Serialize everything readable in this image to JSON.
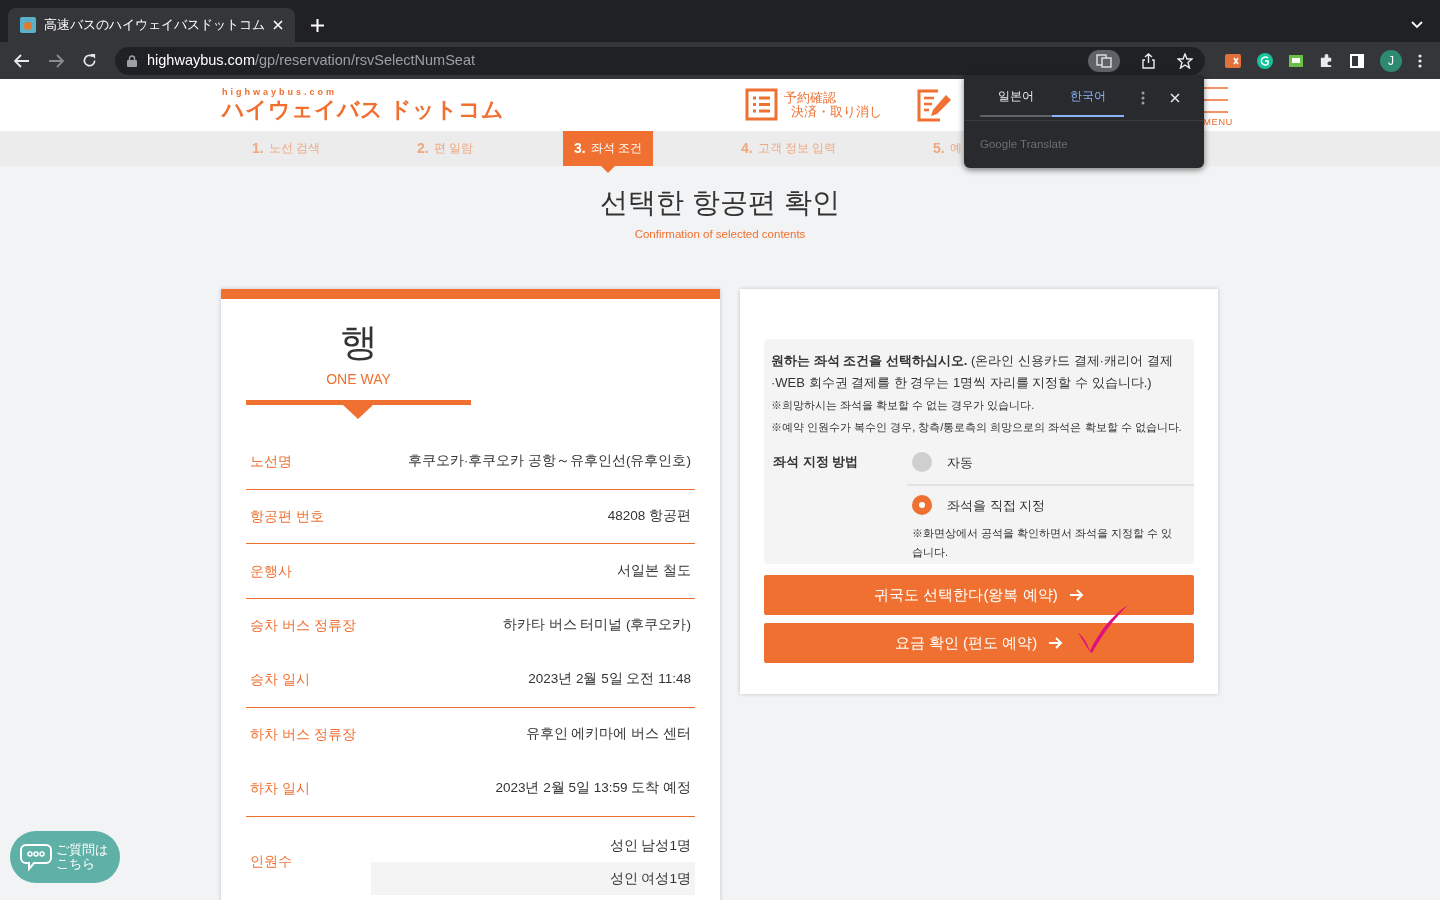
{
  "browser": {
    "tab_title": "高速バスのハイウェイバスドットコム",
    "url_host": "highwaybus.com",
    "url_path": "/gp/reservation/rsvSelectNumSeat",
    "profile_initial": "J"
  },
  "translate_popup": {
    "tabs": [
      {
        "label": "일본어",
        "selected": false
      },
      {
        "label": "한국어",
        "selected": true
      }
    ],
    "footer": "Google Translate"
  },
  "header": {
    "logo_small": "highwaybus.com",
    "logo": "ハイウェイバス ドットコム",
    "links": [
      {
        "line1": "予約確認",
        "line2": "決済・取り消し"
      }
    ],
    "menu": "MENU"
  },
  "steps": [
    {
      "number": "1.",
      "label": "노선 검색",
      "selected": false
    },
    {
      "number": "2.",
      "label": "편 일람",
      "selected": false
    },
    {
      "number": "3.",
      "label": "좌석 조건",
      "selected": true
    },
    {
      "number": "4.",
      "label": "고객 정보 입력",
      "selected": false
    },
    {
      "number": "5.",
      "label": "예",
      "selected": false
    }
  ],
  "title": "선택한 항공편 확인",
  "subtitle": "Confirmation of selected contents",
  "trip": {
    "kind_label": "행",
    "kind_sub": "ONE WAY",
    "rows": [
      {
        "label": "노선명",
        "values": [
          "후쿠오카·후쿠오카 공항～유후인선(유후인호)"
        ],
        "ruled_above": false
      },
      {
        "label": "항공편 번호",
        "values": [
          "48208 항공편"
        ],
        "ruled_above": true
      },
      {
        "label": "운행사",
        "values": [
          "서일본 철도"
        ],
        "ruled_above": true
      },
      {
        "label": "승차 버스 정류장",
        "values": [
          "하카타 버스 터미널 (후쿠오카)"
        ],
        "ruled_above": true
      },
      {
        "label": "승차 일시",
        "values": [
          "2023년 2월 5일 오전 11:48"
        ],
        "ruled_above": false
      },
      {
        "label": "하차 버스 정류장",
        "values": [
          "유후인 에키마에 버스 센터"
        ],
        "ruled_above": true
      },
      {
        "label": "하차 일시",
        "values": [
          "2023년 2월 5일 13:59 도착 예정"
        ],
        "ruled_above": false
      },
      {
        "label": "인원수",
        "values": [
          "성인 남성1명",
          "성인 여성1명"
        ],
        "ruled_above": true
      }
    ]
  },
  "seat": {
    "intro": "**원하는 좌석 조건을 선택하십시오.** (온라인 신용카드 결제·캐리어 결제·WEB 회수권 결제를 한 경우는 1명씩 자리를 지정할 수 있습니다.)",
    "notes": [
      "※희망하시는 좌석을 확보할 수 없는 경우가 있습니다.",
      "※예약 인원수가 복수인 경우, 창측/통로측의 희망으로의 좌석은 확보할 수 없습니다."
    ],
    "method_label": "좌석 지정 방법",
    "options": [
      {
        "label": "자동",
        "selected": false
      },
      {
        "label": "좌석을 직접 지정",
        "selected": true,
        "note": "※화면상에서 공석을 확인하면서 좌석을 지정할 수 있습니다."
      }
    ]
  },
  "buttons": [
    "귀국도 선택한다(왕복 예약)",
    "요금 확인 (편도 예약)"
  ],
  "chat_button": {
    "line1": "ご質問は",
    "line2": "こちら"
  }
}
